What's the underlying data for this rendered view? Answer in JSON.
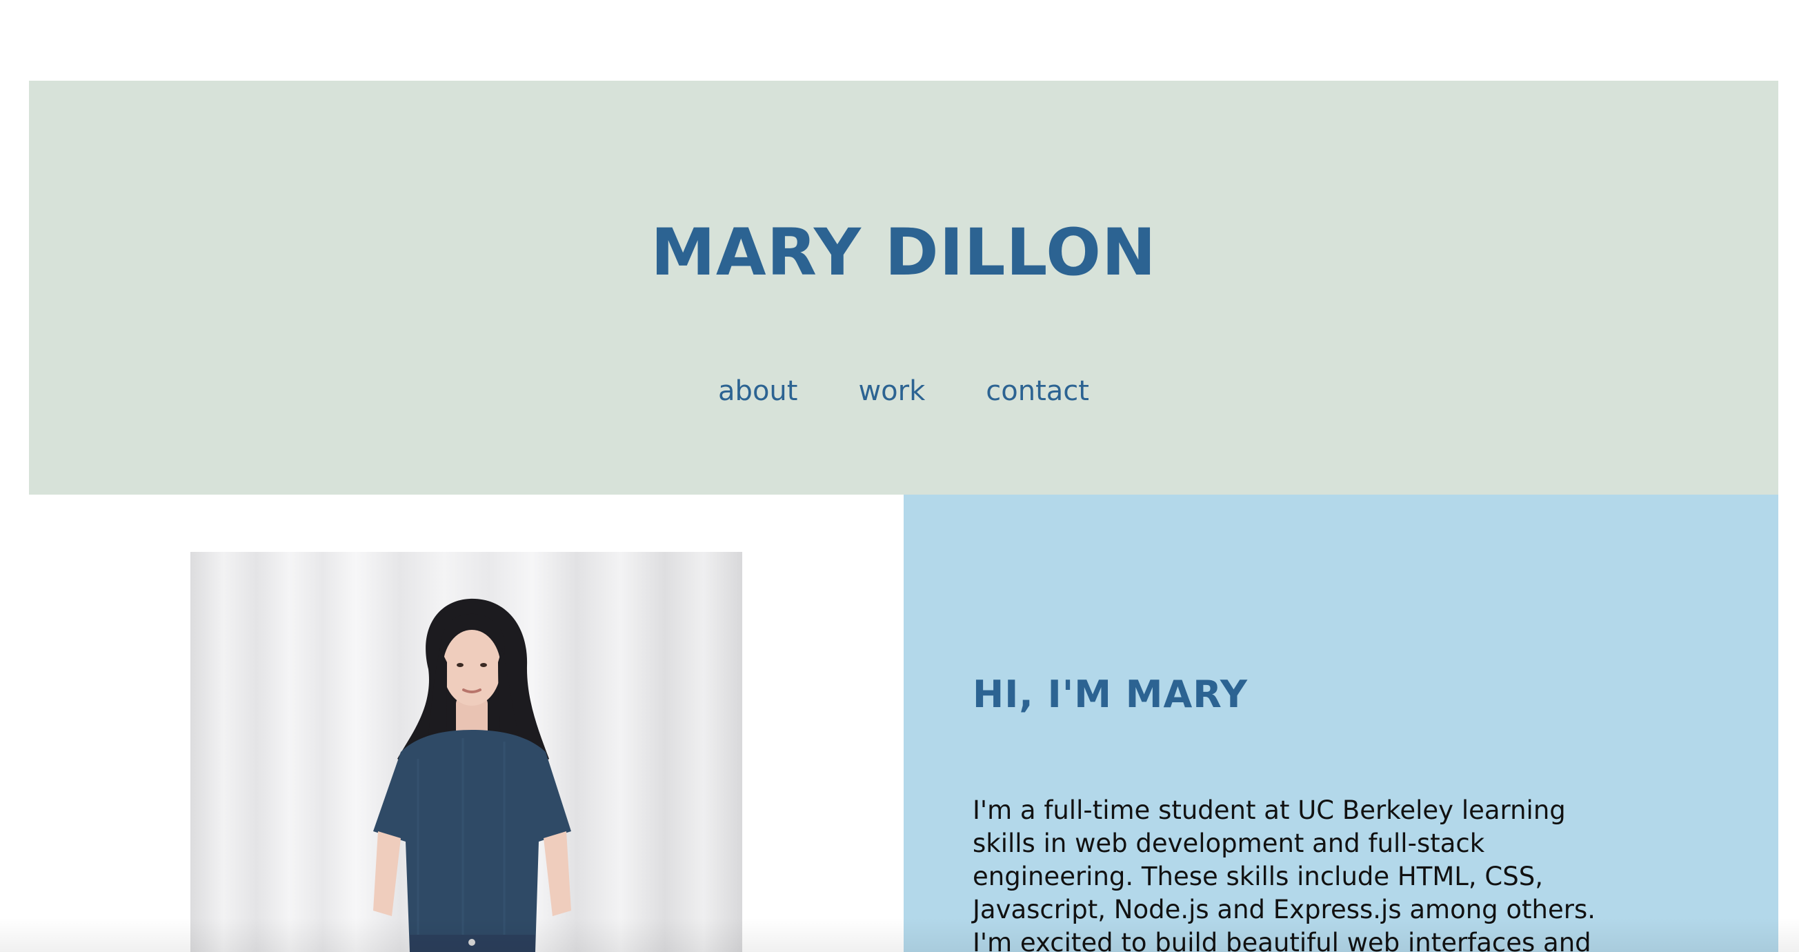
{
  "header": {
    "title": "MARY DILLON",
    "nav": [
      {
        "label": "about"
      },
      {
        "label": "work"
      },
      {
        "label": "contact"
      }
    ],
    "background": "#d7e2d9",
    "accent": "#2c6392"
  },
  "about": {
    "heading": "HI, I'M MARY",
    "body": "I'm a full-time student at UC Berkeley learning skills in web development and full-stack engineering. These skills include HTML, CSS, Javascript, Node.js and Express.js among others. I'm excited to build beautiful web interfaces and applications. You can",
    "background": "#b3d8ea"
  }
}
